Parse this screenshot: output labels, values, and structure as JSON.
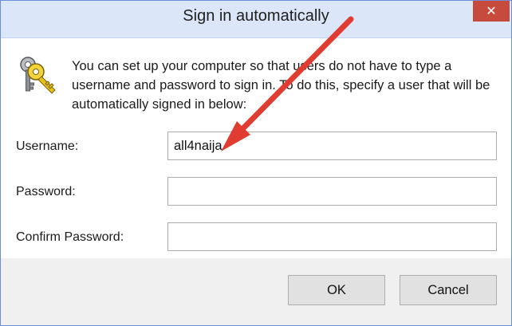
{
  "window": {
    "title": "Sign in automatically",
    "close_label": "✕"
  },
  "description": "You can set up your computer so that users do not have to type a username and password to sign in. To do this, specify a user that will be automatically signed in below:",
  "fields": {
    "username": {
      "label": "Username:",
      "value": "all4naija"
    },
    "password": {
      "label": "Password:",
      "value": ""
    },
    "confirm_password": {
      "label": "Confirm Password:",
      "value": ""
    }
  },
  "buttons": {
    "ok": "OK",
    "cancel": "Cancel"
  },
  "icons": {
    "keys": "keys-icon",
    "arrow": "annotation-arrow",
    "close": "close-icon"
  },
  "colors": {
    "titlebar": "#dbe6f9",
    "close_button": "#c74b3c",
    "arrow": "#e03c31",
    "key_gold": "#e8c21a",
    "key_gray": "#8d9197"
  }
}
